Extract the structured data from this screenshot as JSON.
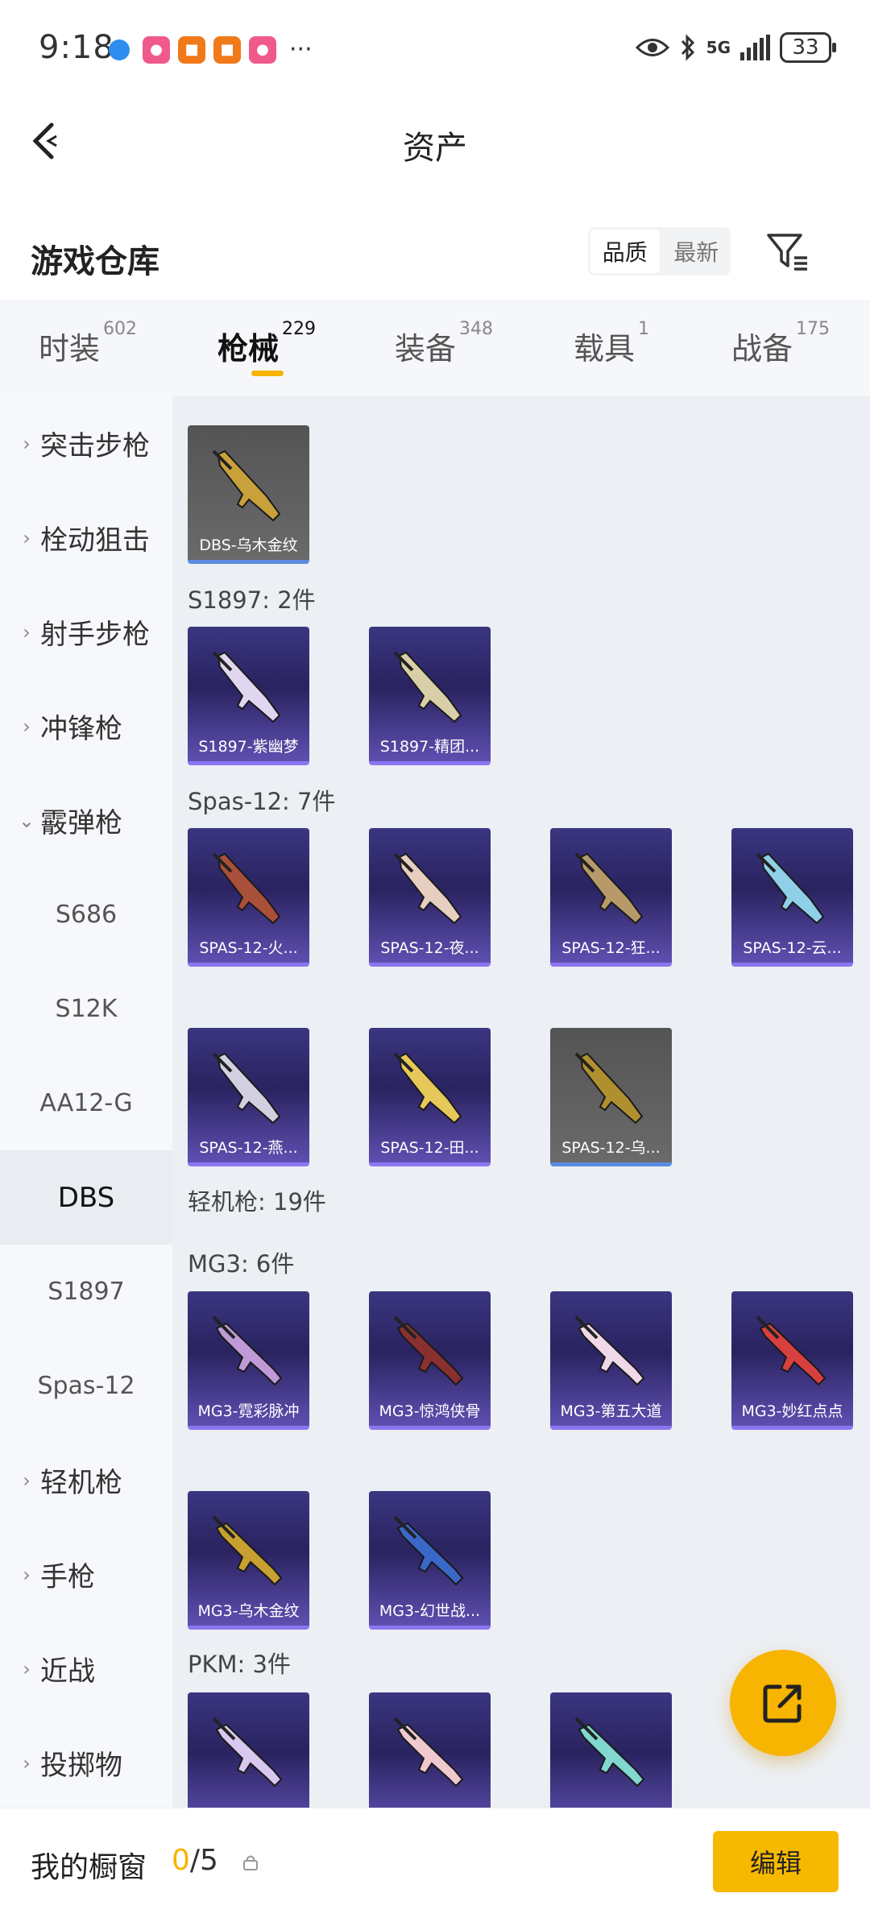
{
  "status_bar": {
    "time": "9:18",
    "network": "5G",
    "battery": "33",
    "more": "···",
    "icons": [
      "browser-icon",
      "app-icon-1",
      "app-icon-2",
      "app-icon-3",
      "app-icon-4",
      "eye-icon",
      "bluetooth-icon",
      "signal-icon",
      "battery-icon"
    ]
  },
  "header": {
    "title": "资产",
    "back_icon": "chevron-left-icon"
  },
  "warehouse": {
    "title": "游戏仓库",
    "sort_options": [
      "品质",
      "最新"
    ],
    "sort_selected": "品质",
    "filter_icon": "filter-icon"
  },
  "tabs": [
    {
      "label": "时装",
      "count": "602"
    },
    {
      "label": "枪械",
      "count": "229",
      "active": true
    },
    {
      "label": "装备",
      "count": "348"
    },
    {
      "label": "载具",
      "count": "1"
    },
    {
      "label": "战备",
      "count": "175"
    }
  ],
  "sidebar": {
    "items": [
      {
        "label": "突击步枪",
        "type": "category",
        "expanded": false
      },
      {
        "label": "栓动狙击",
        "type": "category",
        "expanded": false
      },
      {
        "label": "射手步枪",
        "type": "category",
        "expanded": false
      },
      {
        "label": "冲锋枪",
        "type": "category",
        "expanded": false
      },
      {
        "label": "霰弹枪",
        "type": "category",
        "expanded": true
      },
      {
        "label": "S686",
        "type": "sub"
      },
      {
        "label": "S12K",
        "type": "sub"
      },
      {
        "label": "AA12-G",
        "type": "sub"
      },
      {
        "label": "DBS",
        "type": "sub",
        "selected": true
      },
      {
        "label": "S1897",
        "type": "sub"
      },
      {
        "label": "Spas-12",
        "type": "sub"
      },
      {
        "label": "轻机枪",
        "type": "category",
        "expanded": false
      },
      {
        "label": "手枪",
        "type": "category",
        "expanded": false
      },
      {
        "label": "近战",
        "type": "category",
        "expanded": false
      },
      {
        "label": "投掷物",
        "type": "category",
        "expanded": false
      }
    ]
  },
  "groups": [
    {
      "label": "",
      "cards": [
        {
          "name": "DBS-乌木金纹",
          "rarity": "gray",
          "color": "#c9a13a"
        }
      ]
    },
    {
      "label": "S1897: 2件",
      "cards": [
        {
          "name": "S1897-紫幽梦",
          "rarity": "purple",
          "color": "#e0d6f0"
        },
        {
          "name": "S1897-精团...",
          "rarity": "purple",
          "color": "#d8cfa8"
        }
      ]
    },
    {
      "label": "Spas-12: 7件",
      "cards": [
        {
          "name": "SPAS-12-火...",
          "rarity": "purple",
          "color": "#a8503a"
        },
        {
          "name": "SPAS-12-夜...",
          "rarity": "purple",
          "color": "#e6cfc0"
        },
        {
          "name": "SPAS-12-狂...",
          "rarity": "purple",
          "color": "#b89a6a"
        },
        {
          "name": "SPAS-12-云...",
          "rarity": "purple",
          "color": "#8fd0e8"
        },
        {
          "name": "SPAS-12-燕...",
          "rarity": "purple",
          "color": "#d0d0e0"
        },
        {
          "name": "SPAS-12-田...",
          "rarity": "purple",
          "color": "#e6c85a"
        },
        {
          "name": "SPAS-12-乌...",
          "rarity": "gray",
          "color": "#b0902e"
        }
      ]
    },
    {
      "label": "轻机枪: 19件",
      "cards": []
    },
    {
      "label": "MG3: 6件",
      "cards": [
        {
          "name": "MG3-霓彩脉冲",
          "rarity": "purple",
          "color": "#c09ad8"
        },
        {
          "name": "MG3-惊鸿侠骨",
          "rarity": "purple",
          "color": "#8a3030"
        },
        {
          "name": "MG3-第五大道",
          "rarity": "purple",
          "color": "#f0d8e8"
        },
        {
          "name": "MG3-妙红点点",
          "rarity": "purple",
          "color": "#d84040"
        },
        {
          "name": "MG3-乌木金纹",
          "rarity": "purple",
          "color": "#c8a030"
        },
        {
          "name": "MG3-幻世战...",
          "rarity": "purple",
          "color": "#3a68c8"
        }
      ]
    },
    {
      "label": "PKM: 3件",
      "cards": [
        {
          "name": "",
          "rarity": "purple",
          "color": "#d8c8f0"
        },
        {
          "name": "",
          "rarity": "purple",
          "color": "#f0c8d0"
        },
        {
          "name": "",
          "rarity": "purple",
          "color": "#80d8d0"
        }
      ]
    }
  ],
  "fab": {
    "icon": "share-external-icon"
  },
  "bottom_bar": {
    "title": "我的橱窗",
    "count_current": "0",
    "count_total": "/5",
    "lock_icon": "lock-icon",
    "edit_label": "编辑"
  },
  "colors": {
    "accent": "#f6b400",
    "purple_card": "#3a3680",
    "gray_card": "#5a5a5a",
    "sidebar_bg": "#f6f8fb",
    "main_bg": "#eceff3"
  }
}
